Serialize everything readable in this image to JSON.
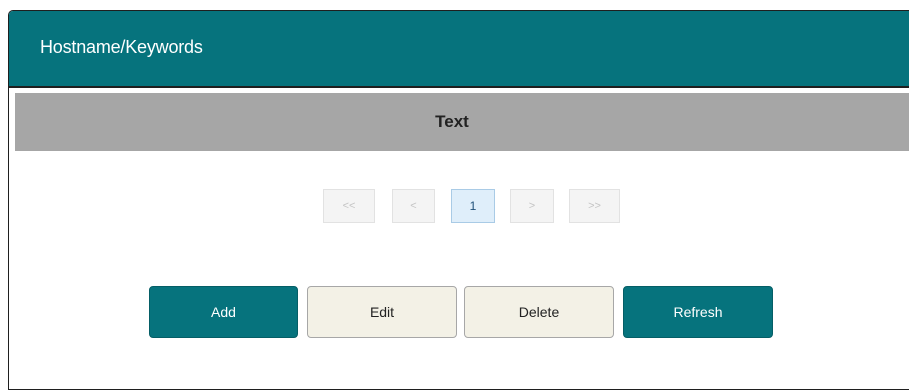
{
  "panel": {
    "title": "Hostname/Keywords"
  },
  "table": {
    "columns": [
      "Text"
    ],
    "rows": []
  },
  "pagination": {
    "first": "<<",
    "prev": "<",
    "current_page": "1",
    "next": ">",
    "last": ">>"
  },
  "actions": {
    "add": "Add",
    "edit": "Edit",
    "delete": "Delete",
    "refresh": "Refresh"
  },
  "colors": {
    "header_teal": "#06737d",
    "table_header_gray": "#a6a6a6",
    "secondary_button": "#f3f1e6",
    "current_page_bg": "#dfeefa"
  }
}
